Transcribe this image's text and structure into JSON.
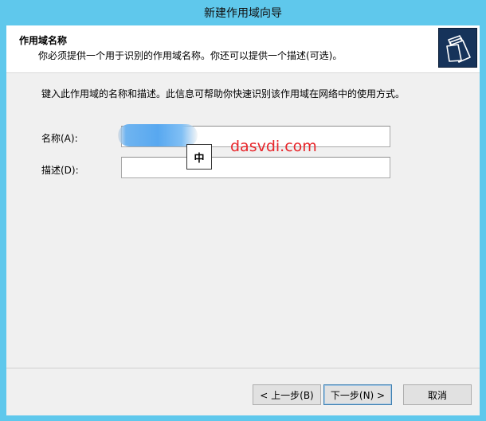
{
  "window": {
    "title": "新建作用域向导"
  },
  "header": {
    "title": "作用域名称",
    "subtitle": "你必须提供一个用于识别的作用域名称。你还可以提供一个描述(可选)。",
    "image_icon": "folders-icon"
  },
  "main": {
    "instructions": "键入此作用域的名称和描述。此信息可帮助你快速识别该作用域在网络中的使用方式。",
    "name_label": "名称(A):",
    "name_value": "",
    "description_label": "描述(D):",
    "description_value": ""
  },
  "ime_indicator": "中",
  "watermark": "dasvdi.com",
  "buttons": {
    "back": "< 上一步(B)",
    "next": "下一步(N) >",
    "cancel": "取消"
  },
  "colors": {
    "title_bar": "#5fc8ec",
    "watermark": "#e8262b"
  }
}
